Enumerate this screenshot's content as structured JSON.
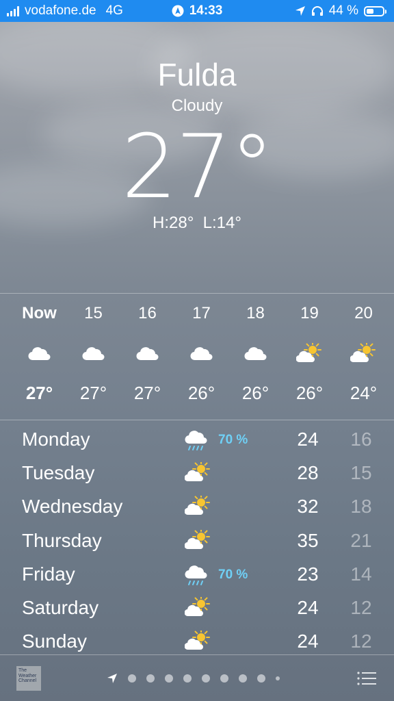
{
  "status_bar": {
    "carrier": "vodafone.de",
    "network": "4G",
    "time": "14:33",
    "battery": "44 %",
    "battery_level": 0.44
  },
  "location": {
    "city": "Fulda",
    "condition": "Cloudy",
    "temperature": "27°",
    "hi_lo": "H:28°  L:14°"
  },
  "hourly": [
    {
      "hour": "Now",
      "icon": "cloud-icon",
      "temp": "27°"
    },
    {
      "hour": "15",
      "icon": "cloud-icon",
      "temp": "27°"
    },
    {
      "hour": "16",
      "icon": "cloud-icon",
      "temp": "27°"
    },
    {
      "hour": "17",
      "icon": "cloud-icon",
      "temp": "26°"
    },
    {
      "hour": "18",
      "icon": "cloud-icon",
      "temp": "26°"
    },
    {
      "hour": "19",
      "icon": "partly-sunny-icon",
      "temp": "26°"
    },
    {
      "hour": "20",
      "icon": "partly-sunny-icon",
      "temp": "24°"
    }
  ],
  "daily": [
    {
      "day": "Monday",
      "icon": "rain-icon",
      "precip": "70 %",
      "high": "24",
      "low": "16"
    },
    {
      "day": "Tuesday",
      "icon": "partly-sunny-icon",
      "precip": "",
      "high": "28",
      "low": "15"
    },
    {
      "day": "Wednesday",
      "icon": "partly-sunny-icon",
      "precip": "",
      "high": "32",
      "low": "18"
    },
    {
      "day": "Thursday",
      "icon": "partly-sunny-icon",
      "precip": "",
      "high": "35",
      "low": "21"
    },
    {
      "day": "Friday",
      "icon": "rain-icon",
      "precip": "70 %",
      "high": "23",
      "low": "14"
    },
    {
      "day": "Saturday",
      "icon": "partly-sunny-icon",
      "precip": "",
      "high": "24",
      "low": "12"
    },
    {
      "day": "Sunday",
      "icon": "partly-sunny-icon",
      "precip": "",
      "high": "24",
      "low": "12"
    }
  ],
  "bottom_bar": {
    "logo_text": "The Weather Channel",
    "page_count": 9,
    "active_page": 0
  },
  "colors": {
    "status_bar": "#1f8bf0",
    "sun": "#f7c531",
    "precip": "#6fd0f6"
  }
}
